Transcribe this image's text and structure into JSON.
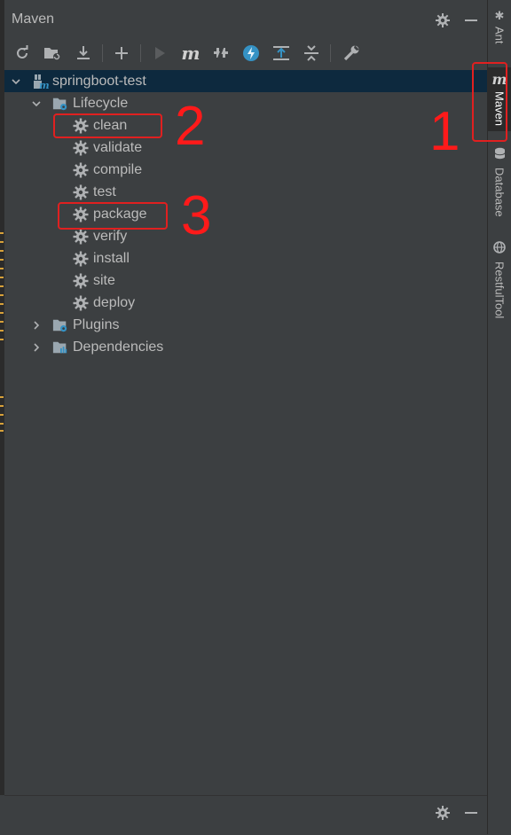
{
  "panel": {
    "title": "Maven"
  },
  "tree": {
    "root": "springboot-test",
    "lifecycle_label": "Lifecycle",
    "goals": [
      "clean",
      "validate",
      "compile",
      "test",
      "package",
      "verify",
      "install",
      "site",
      "deploy"
    ],
    "plugins_label": "Plugins",
    "dependencies_label": "Dependencies"
  },
  "side_tabs": [
    "Ant",
    "Maven",
    "Database",
    "RestfulTool"
  ],
  "annotations": [
    "1",
    "2",
    "3"
  ],
  "colors": {
    "selection": "#0d293e",
    "annotation": "#e02020",
    "bg": "#3c3f41"
  }
}
